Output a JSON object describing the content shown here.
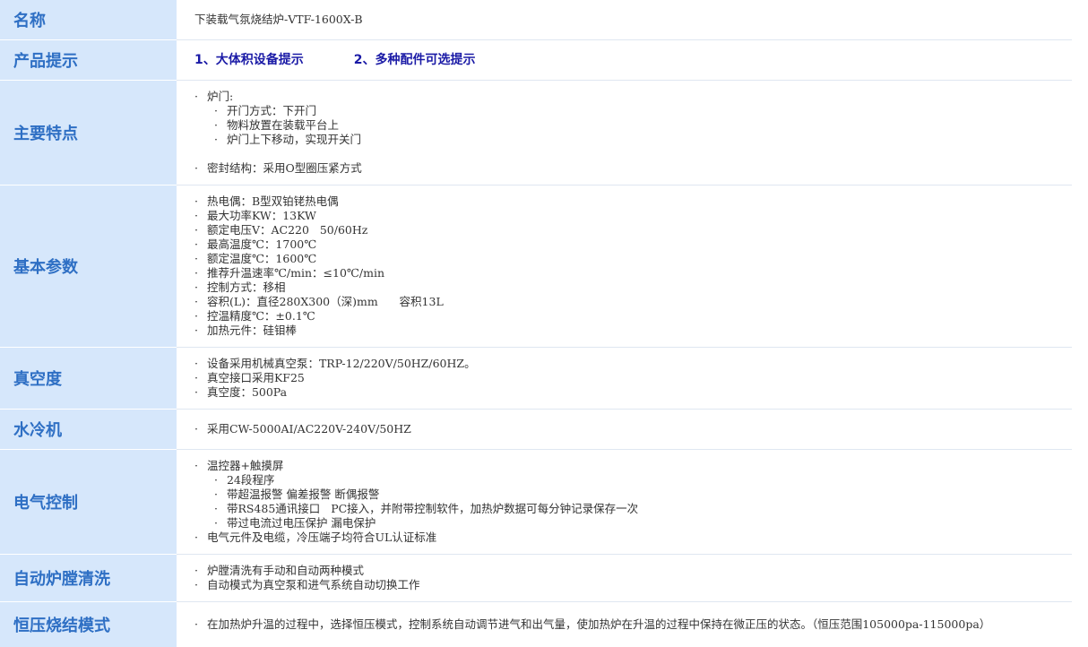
{
  "rows": {
    "name": {
      "label": "名称",
      "value": "下装载气氛烧结炉-VTF-1600X-B"
    },
    "hint": {
      "label": "产品提示",
      "items": [
        "1、大体积设备提示",
        "2、多种配件可选提示"
      ]
    },
    "features": {
      "label": "主要特点",
      "door": "炉门:",
      "door_items": [
        "开门方式：下开门",
        "物料放置在装载平台上",
        "炉门上下移动，实现开关门"
      ],
      "seal": "密封结构：采用O型圈压紧方式"
    },
    "basic": {
      "label": "基本参数",
      "items": [
        "热电偶：B型双铂铑热电偶",
        "最大功率KW：13KW",
        "额定电压V：AC220   50/60Hz",
        "最高温度℃：1700℃",
        "额定温度℃：1600℃",
        "推荐升温速率℃/min：≤10℃/min",
        "控制方式：移相",
        "容积(L)：直径280X300（深)mm      容积13L",
        "控温精度℃：±0.1℃",
        "加热元件：硅钼棒"
      ]
    },
    "vacuum": {
      "label": "真空度",
      "items": [
        "设备采用机械真空泵：TRP-12/220V/50HZ/60HZ。",
        "真空接口采用KF25",
        "真空度：500Pa"
      ]
    },
    "cooler": {
      "label": "水冷机",
      "items": [
        "采用CW-5000AI/AC220V-240V/50HZ"
      ]
    },
    "electric": {
      "label": "电气控制",
      "main": "温控器+触摸屏",
      "sub": [
        "24段程序",
        "带超温报警 偏差报警 断偶报警",
        "带RS485通讯接口   PC接入，并附带控制软件，加热炉数据可每分钟记录保存一次",
        "带过电流过电压保护 漏电保护"
      ],
      "last": "电气元件及电缆，冷压端子均符合UL认证标准"
    },
    "cleaning": {
      "label": "自动炉膛清洗",
      "items": [
        "炉膛清洗有手动和自动两种模式",
        "自动模式为真空泵和进气系统自动切换工作"
      ]
    },
    "constant": {
      "label": "恒压烧结模式",
      "text": "在加热炉升温的过程中，选择恒压模式，控制系统自动调节进气和出气量，使加热炉在升温的过程中保持在微正压的状态。（恒压范围105000pa-115000pa）"
    }
  }
}
